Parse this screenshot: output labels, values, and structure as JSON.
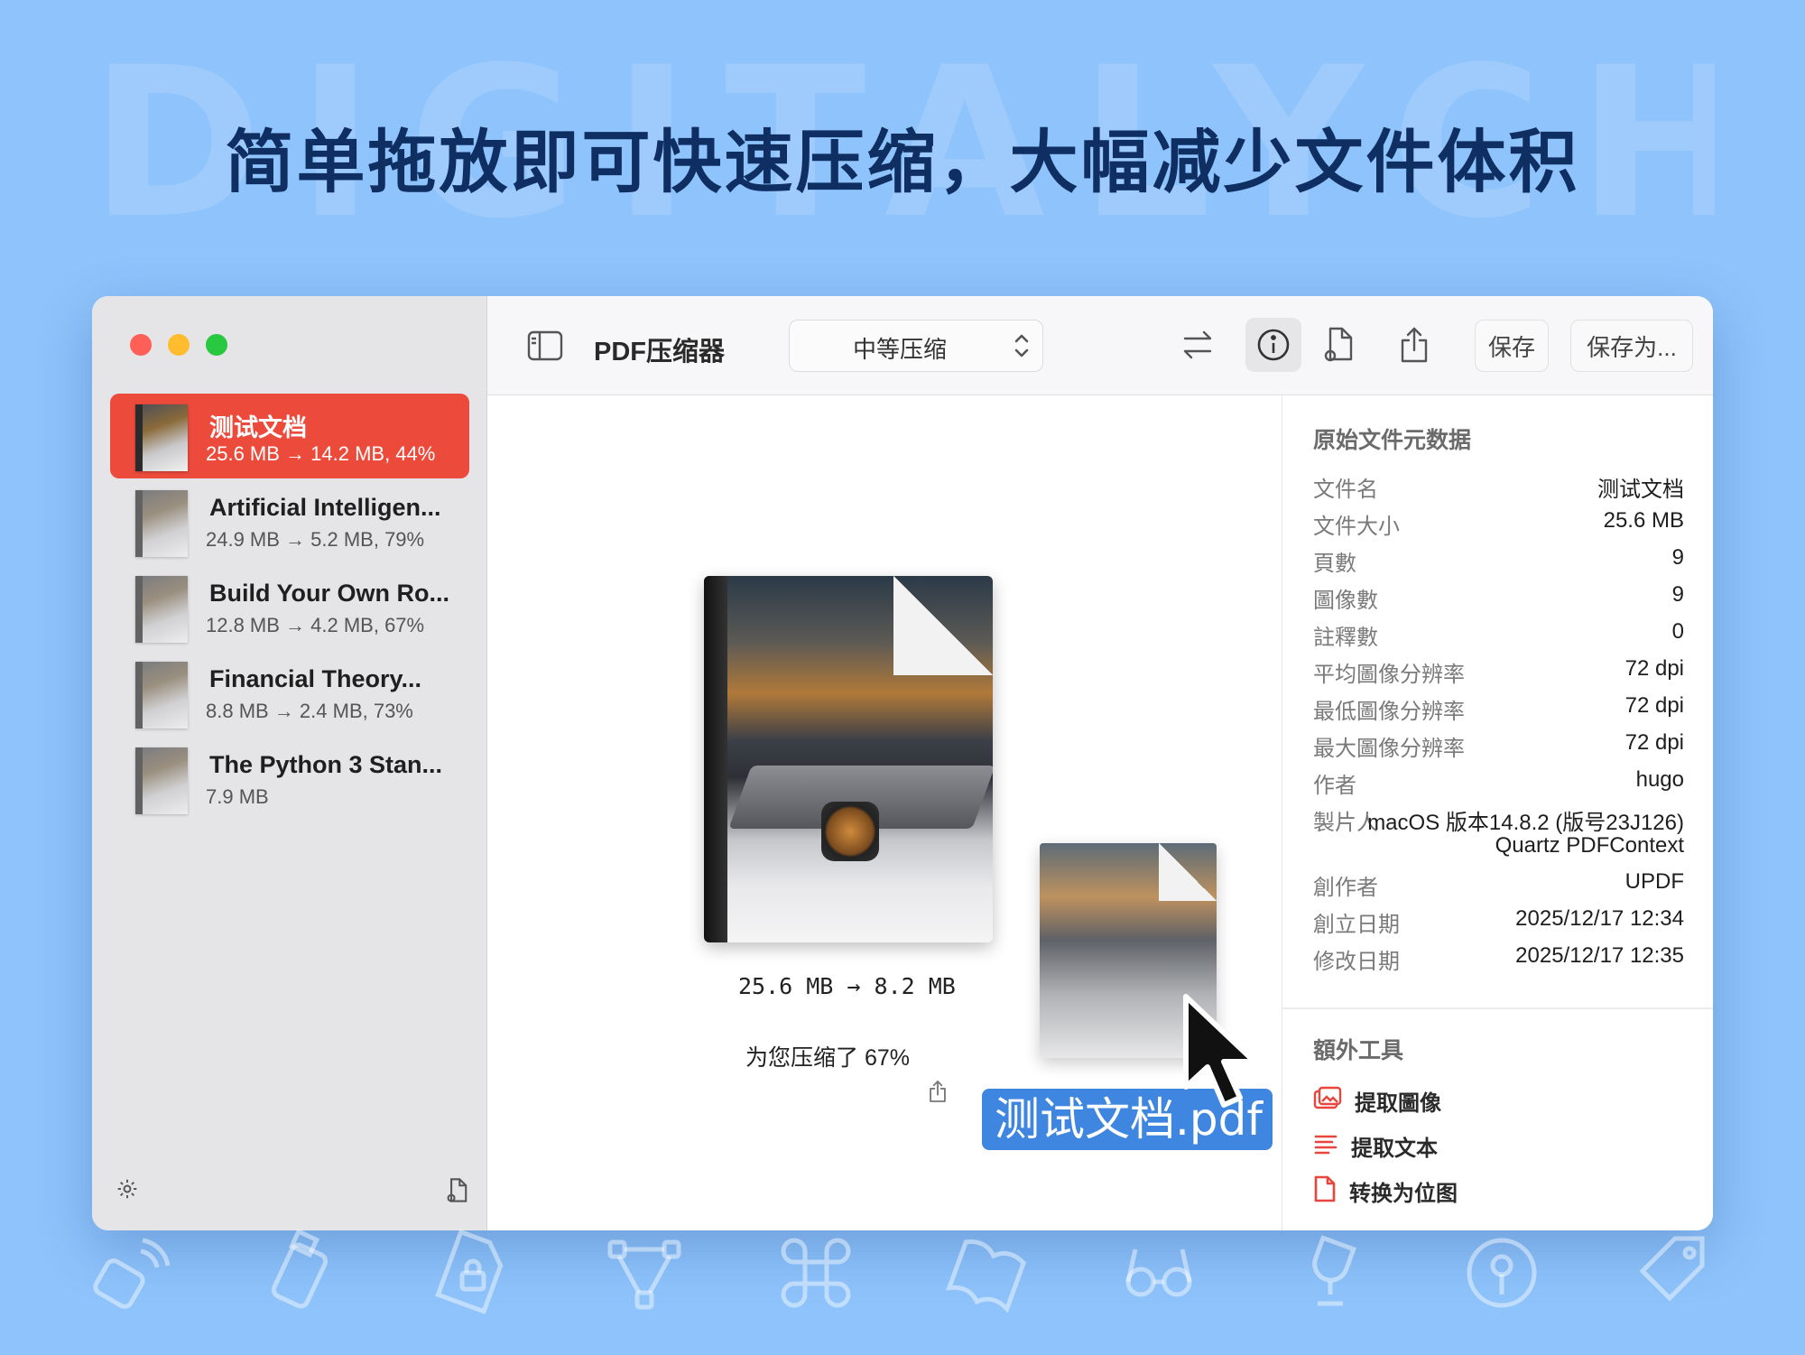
{
  "watermark": "DIGITALYCHEE",
  "headline": "简单拖放即可快速压缩，大幅减少文件体积",
  "sidebar": {
    "files": [
      {
        "name": "测试文档",
        "detail": "25.6 MB → 14.2 MB, 44%",
        "selected": true
      },
      {
        "name": "Artificial Intelligen...",
        "detail": "24.9 MB → 5.2 MB, 79%"
      },
      {
        "name": "Build Your Own Ro...",
        "detail": "12.8 MB → 4.2 MB, 67%"
      },
      {
        "name": "Financial Theory...",
        "detail": "8.8 MB → 2.4 MB, 73%"
      },
      {
        "name": "The Python 3 Stan...",
        "detail": "7.9 MB"
      }
    ]
  },
  "toolbar": {
    "app_title": "PDF压缩器",
    "compression_level": "中等压缩",
    "save_label": "保存",
    "save_as_label": "保存为..."
  },
  "main": {
    "ratio": "25.6 MB → 8.2 MB",
    "saved": "为您压缩了 67%",
    "drag_filename": "测试文档.pdf"
  },
  "inspector": {
    "title": "原始文件元数据",
    "rows": [
      {
        "key": "文件名",
        "value": "测试文档"
      },
      {
        "key": "文件大小",
        "value": "25.6 MB"
      },
      {
        "key": "頁數",
        "value": "9"
      },
      {
        "key": "圖像數",
        "value": "9"
      },
      {
        "key": "註釋數",
        "value": "0"
      },
      {
        "key": "平均圖像分辨率",
        "value": "72 dpi"
      },
      {
        "key": "最低圖像分辨率",
        "value": "72 dpi"
      },
      {
        "key": "最大圖像分辨率",
        "value": "72 dpi"
      },
      {
        "key": "作者",
        "value": "hugo"
      },
      {
        "key": "製片人",
        "value": "macOS 版本14.8.2 (版号23J126)",
        "value2": "Quartz PDFContext"
      },
      {
        "key": "創作者",
        "value": "UPDF"
      },
      {
        "key": "創立日期",
        "value": "2025/12/17 12:34"
      },
      {
        "key": "修改日期",
        "value": "2025/12/17 12:35"
      }
    ],
    "extra_title": "額外工具",
    "tools": [
      "提取圖像",
      "提取文本",
      "转换为位图"
    ]
  },
  "colors": {
    "background": "#8ec3fb",
    "headline": "#0f2f63",
    "selection": "#ec4b3c",
    "accent": "#3f86e0",
    "tool_icon": "#e8453c"
  },
  "icons": [
    "sidebar-toggle-icon",
    "chevron-updown-icon",
    "swap-icon",
    "info-icon",
    "doc-gear-icon",
    "share-icon",
    "gear-icon",
    "doc-settings-icon",
    "extract-image-icon",
    "extract-text-icon",
    "bitmap-doc-icon",
    "cursor-icon"
  ]
}
